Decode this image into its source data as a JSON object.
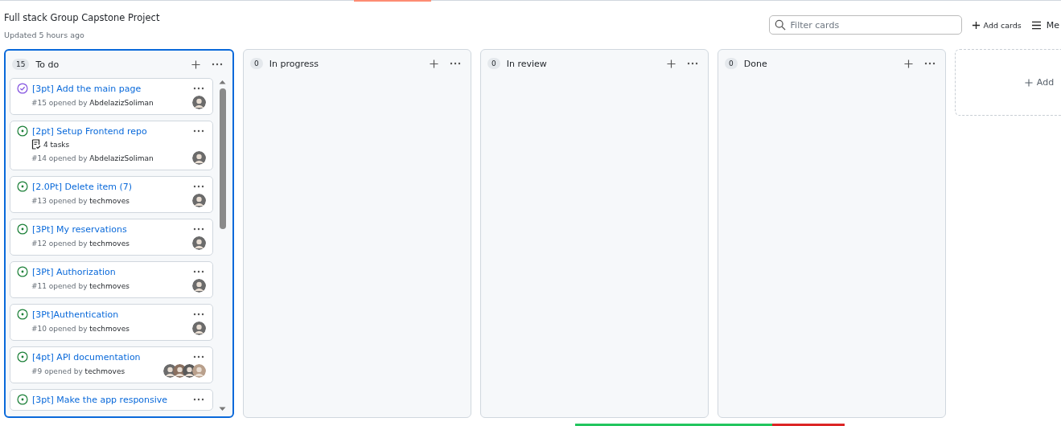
{
  "project": {
    "title": "Full stack Group Capstone Project",
    "updated": "Updated 5 hours ago"
  },
  "toolbar": {
    "filter": {
      "placeholder": "Filter cards"
    },
    "add_cards": "Add cards",
    "menu": "Me"
  },
  "columns": [
    {
      "count": "15",
      "name": "To do",
      "selected": true,
      "cards": [
        {
          "title": "[3pt] Add the main page",
          "kind": "closed",
          "meta": "#15 opened by ",
          "author": "AbdelazizSoliman",
          "assignees": [
            {
              "kind": "avatar"
            }
          ]
        },
        {
          "title": "[2pt] Setup Frontend repo",
          "kind": "open",
          "tasks": "4 tasks",
          "meta": "#14 opened by ",
          "author": "AbdelazizSoliman",
          "assignees": [
            {
              "kind": "avatar"
            }
          ]
        },
        {
          "title": "[2.0Pt] Delete item (7)",
          "kind": "open",
          "meta": "#13 opened by ",
          "author": "techmoves",
          "assignees": [
            {
              "kind": "avatar"
            }
          ]
        },
        {
          "title": "[3Pt] My reservations",
          "kind": "open",
          "meta": "#12 opened by ",
          "author": "techmoves",
          "assignees": [
            {
              "kind": "avatar"
            }
          ]
        },
        {
          "title": "[3Pt] Authorization",
          "kind": "open",
          "meta": "#11 opened by ",
          "author": "techmoves",
          "assignees": [
            {
              "kind": "avatar"
            }
          ]
        },
        {
          "title": "[3Pt]Authentication",
          "kind": "open",
          "meta": "#10 opened by ",
          "author": "techmoves",
          "assignees": [
            {
              "kind": "avatar"
            }
          ]
        },
        {
          "title": "[4pt] API documentation",
          "kind": "open",
          "meta": "#9 opened by ",
          "author": "techmoves",
          "assignees": [
            {
              "kind": "avatar"
            },
            {
              "kind": "avatar"
            },
            {
              "kind": "avatar"
            },
            {
              "kind": "avatar"
            }
          ]
        },
        {
          "title": "[3pt] Make the app responsive",
          "kind": "open"
        }
      ]
    },
    {
      "count": "0",
      "name": "In progress",
      "selected": false
    },
    {
      "count": "0",
      "name": "In review",
      "selected": false
    },
    {
      "count": "0",
      "name": "Done",
      "selected": false
    }
  ],
  "add_column": "Add"
}
